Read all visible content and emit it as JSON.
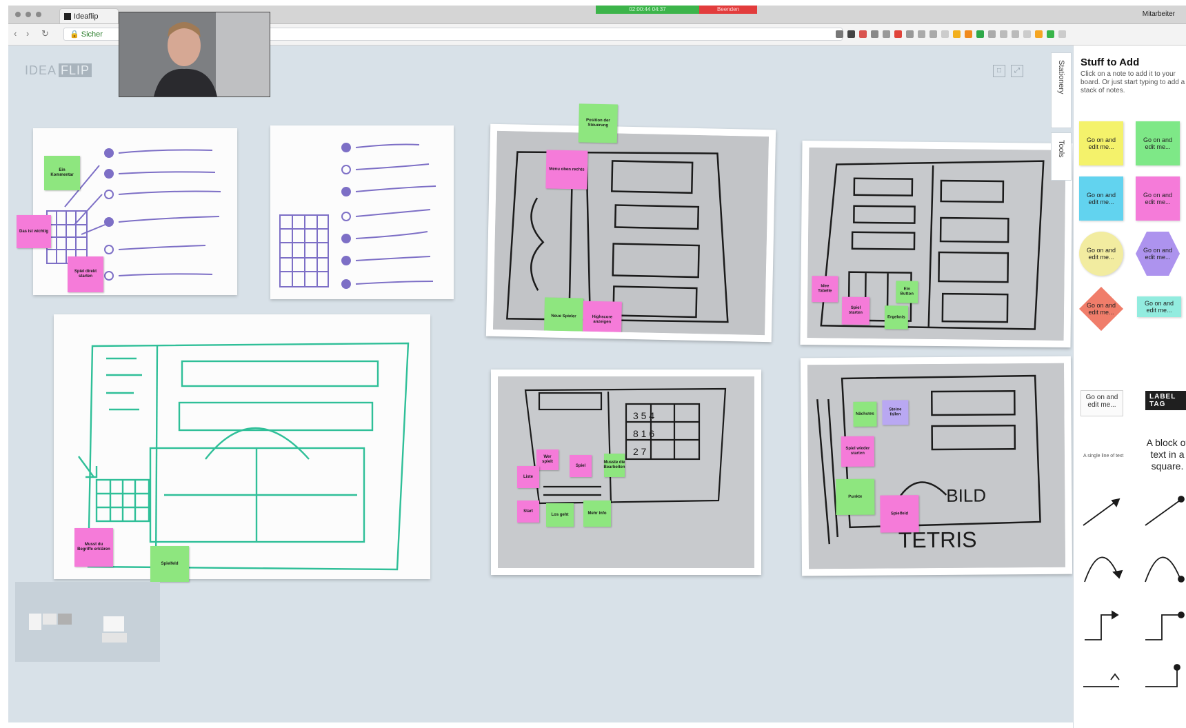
{
  "browser": {
    "tab_title": "Ideaflip",
    "url": "Sicher",
    "call_status": "02:00:44 04:37",
    "call_end": "Beenden",
    "user_label": "Mitarbeiter"
  },
  "app": {
    "logo_text": "IDEA",
    "logo_highlight": "FLIP"
  },
  "side_tabs": [
    "Stationery",
    "Tools"
  ],
  "panel": {
    "title": "Stuff to Add",
    "help": "Click on a note to add it to your board. Or just start typing to add a stack of notes.",
    "notes": [
      {
        "label": "Go on and edit me...",
        "color": "#f4f26b"
      },
      {
        "label": "Go on and edit me...",
        "color": "#7ee887"
      },
      {
        "label": "Go on and edit me...",
        "color": "#62d3ef"
      },
      {
        "label": "Go on and edit me...",
        "color": "#f57bd9"
      },
      {
        "label": "Go on and edit me...",
        "color": "#f2eca0"
      },
      {
        "label": "Go on and edit me...",
        "color": "#ad93ee"
      },
      {
        "label": "Go on and edit me...",
        "color": "#f07d6a"
      },
      {
        "label": "Go on and edit me...",
        "color": "#92ecdf"
      }
    ],
    "shape_text": "Go on and edit me...",
    "label_button": "LABEL TAG",
    "small_label": "A single line of text",
    "block_text": "A block of text in a square."
  },
  "board": {
    "stickies": [
      {
        "text": "Ein Kommentar",
        "color": "green"
      },
      {
        "text": "Das ist wichtig",
        "color": "pink"
      },
      {
        "text": "Spiel direkt starten",
        "color": "pink"
      },
      {
        "text": "Position der Steuerung",
        "color": "green"
      },
      {
        "text": "Menu oben rechts",
        "color": "pink"
      },
      {
        "text": "Neue Spieler",
        "color": "green"
      },
      {
        "text": "Highscore anzeigen",
        "color": "pink"
      },
      {
        "text": "Idee Tabelle",
        "color": "pink"
      },
      {
        "text": "Spiel starten",
        "color": "pink"
      },
      {
        "text": "Ein Button",
        "color": "green"
      },
      {
        "text": "Ergebnis",
        "color": "green"
      },
      {
        "text": "Musste die Bearbeiten",
        "color": "pink"
      },
      {
        "text": "Spiel",
        "color": "pink"
      },
      {
        "text": "Spielfeld",
        "color": "green"
      },
      {
        "text": "Wer spielt",
        "color": "pink"
      },
      {
        "text": "Liste",
        "color": "pink"
      },
      {
        "text": "Start",
        "color": "pink"
      },
      {
        "text": "Los geht",
        "color": "green"
      },
      {
        "text": "Mehr Info",
        "color": "green"
      },
      {
        "text": "Nächstes",
        "color": "purple"
      },
      {
        "text": "Steine fallen",
        "color": "pink"
      },
      {
        "text": "Spiel wieder starten",
        "color": "green"
      },
      {
        "text": "Punkte",
        "color": "pink"
      },
      {
        "text": "Musst du Begriffe erklären",
        "color": "pink"
      },
      {
        "text": "Spielfeld",
        "color": "green"
      }
    ],
    "photo_words": {
      "bild": "BILD",
      "tetris": "TETRIS"
    }
  }
}
